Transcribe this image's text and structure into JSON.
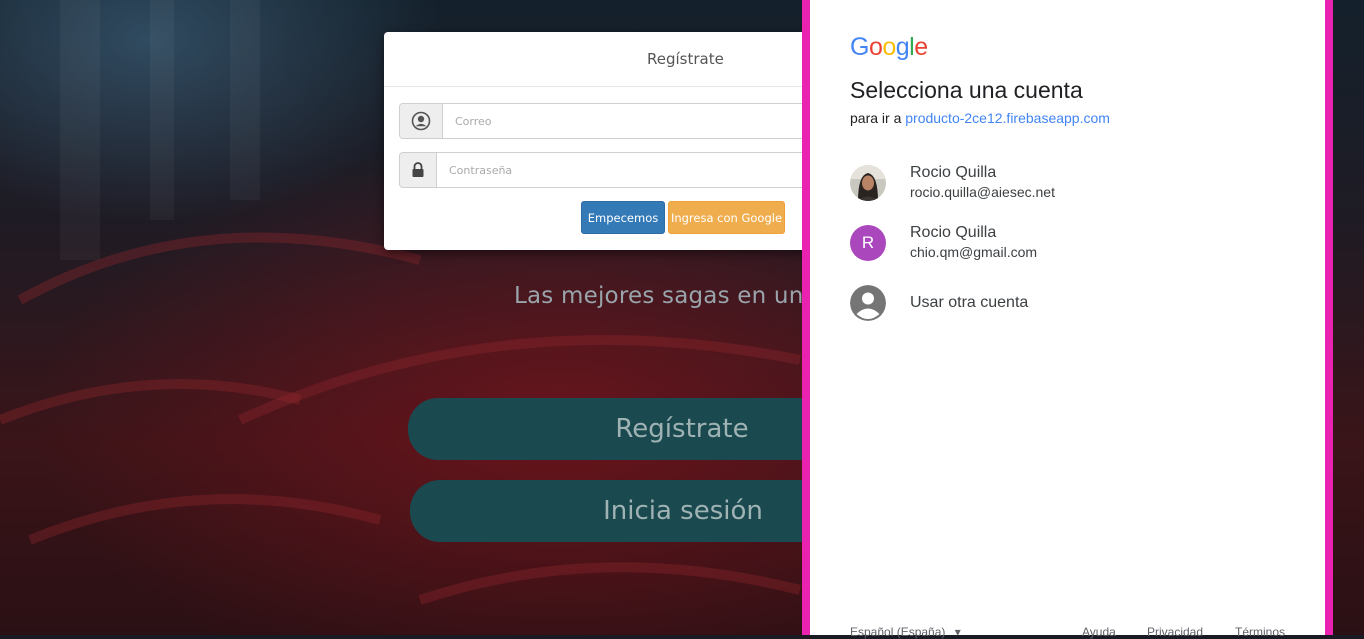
{
  "background_app": {
    "tagline": "Las mejores sagas en un solo",
    "register_big_button": "Regístrate",
    "login_big_button": "Inicia sesión"
  },
  "register_card": {
    "title": "Regístrate",
    "email_placeholder": "Correo",
    "password_placeholder": "Contraseña",
    "start_button": "Empecemos",
    "google_button": "Ingresa con Google"
  },
  "google_chooser": {
    "logo_letters": [
      "G",
      "o",
      "o",
      "g",
      "l",
      "e"
    ],
    "logo_colors": [
      "#4285F4",
      "#EA4335",
      "#FBBC05",
      "#4285F4",
      "#34A853",
      "#EA4335"
    ],
    "title": "Selecciona una cuenta",
    "subtitle_prefix": "para ir a",
    "subtitle_link": "producto-2ce12.firebaseapp.com",
    "accounts": [
      {
        "name": "Rocio Quilla",
        "email": "rocio.quilla@aiesec.net",
        "avatar": "photo"
      },
      {
        "name": "Rocio Quilla",
        "email": "chio.qm@gmail.com",
        "avatar_letter": "R"
      }
    ],
    "other_account": "Usar otra cuenta",
    "footer": {
      "language": "Español (España)",
      "help": "Ayuda",
      "privacy": "Privacidad",
      "terms": "Términos"
    }
  }
}
